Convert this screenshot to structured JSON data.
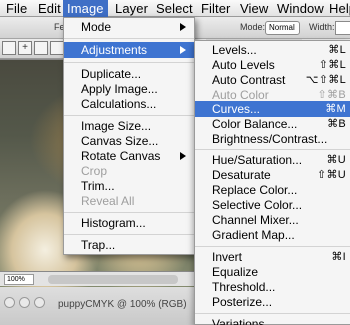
{
  "menubar": {
    "items": [
      "File",
      "Edit",
      "Image",
      "Layer",
      "Select",
      "Filter",
      "View",
      "Window",
      "Help"
    ]
  },
  "options_bar": {
    "feather_label": "Fea",
    "mode_label": "Mode:",
    "mode_value": "Normal",
    "width_label": "Width:"
  },
  "document": {
    "zoom": "100%",
    "title": "puppyCMYK @ 100% (RGB)"
  },
  "image_menu": {
    "items": [
      {
        "label": "Mode"
      },
      {
        "label": "Adjustments"
      },
      {
        "label": "Duplicate..."
      },
      {
        "label": "Apply Image..."
      },
      {
        "label": "Calculations..."
      },
      {
        "label": "Image Size..."
      },
      {
        "label": "Canvas Size..."
      },
      {
        "label": "Rotate Canvas"
      },
      {
        "label": "Crop"
      },
      {
        "label": "Trim..."
      },
      {
        "label": "Reveal All"
      },
      {
        "label": "Histogram..."
      },
      {
        "label": "Trap..."
      }
    ]
  },
  "adjustments_menu": {
    "items": [
      {
        "label": "Levels...",
        "shortcut": "⌘L"
      },
      {
        "label": "Auto Levels",
        "shortcut": "⇧⌘L"
      },
      {
        "label": "Auto Contrast",
        "shortcut": "⌥⇧⌘L"
      },
      {
        "label": "Auto Color",
        "shortcut": "⇧⌘B"
      },
      {
        "label": "Curves...",
        "shortcut": "⌘M"
      },
      {
        "label": "Color Balance...",
        "shortcut": "⌘B"
      },
      {
        "label": "Brightness/Contrast...",
        "shortcut": ""
      },
      {
        "label": "Hue/Saturation...",
        "shortcut": "⌘U"
      },
      {
        "label": "Desaturate",
        "shortcut": "⇧⌘U"
      },
      {
        "label": "Replace Color...",
        "shortcut": ""
      },
      {
        "label": "Selective Color...",
        "shortcut": ""
      },
      {
        "label": "Channel Mixer...",
        "shortcut": ""
      },
      {
        "label": "Gradient Map...",
        "shortcut": ""
      },
      {
        "label": "Invert",
        "shortcut": "⌘I"
      },
      {
        "label": "Equalize",
        "shortcut": ""
      },
      {
        "label": "Threshold...",
        "shortcut": ""
      },
      {
        "label": "Posterize...",
        "shortcut": ""
      },
      {
        "label": "Variations...",
        "shortcut": ""
      }
    ]
  },
  "colors": {
    "highlight": "#3e74d1",
    "disabled_text": "#9e9e9e"
  }
}
